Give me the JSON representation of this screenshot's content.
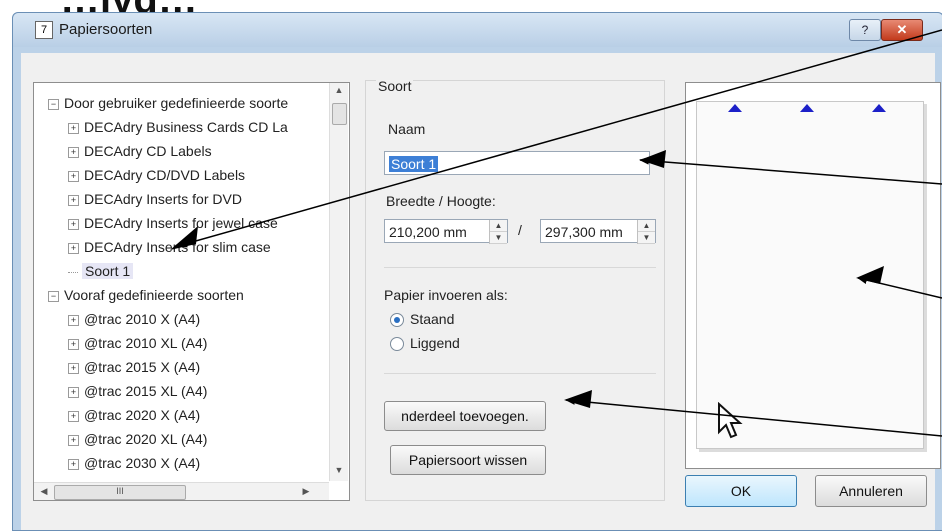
{
  "background_title": "…lyg…",
  "window": {
    "title": "Papiersoorten",
    "help": "?",
    "close": "✕",
    "icon": "7"
  },
  "tree": {
    "items": [
      {
        "label": "Door gebruiker gedefinieerde soorte",
        "exp": "−",
        "level": 0
      },
      {
        "label": "DECAdry Business Cards CD La",
        "exp": "+",
        "level": 1
      },
      {
        "label": "DECAdry CD Labels",
        "exp": "+",
        "level": 1
      },
      {
        "label": "DECAdry CD/DVD Labels",
        "exp": "+",
        "level": 1
      },
      {
        "label": "DECAdry Inserts for DVD",
        "exp": "+",
        "level": 1
      },
      {
        "label": "DECAdry Inserts for jewel case",
        "exp": "+",
        "level": 1
      },
      {
        "label": "DECAdry Inserts for slim case",
        "exp": "+",
        "level": 1
      },
      {
        "label": "Soort 1",
        "exp": "",
        "level": 1,
        "selected": true
      },
      {
        "label": "Vooraf gedefinieerde soorten",
        "exp": "−",
        "level": 0
      },
      {
        "label": "@trac 2010 X (A4)",
        "exp": "+",
        "level": 1
      },
      {
        "label": "@trac 2010 XL (A4)",
        "exp": "+",
        "level": 1
      },
      {
        "label": "@trac 2015 X (A4)",
        "exp": "+",
        "level": 1
      },
      {
        "label": "@trac 2015 XL (A4)",
        "exp": "+",
        "level": 1
      },
      {
        "label": "@trac 2020 X (A4)",
        "exp": "+",
        "level": 1
      },
      {
        "label": "@trac 2020 XL (A4)",
        "exp": "+",
        "level": 1
      },
      {
        "label": "@trac 2030 X (A4)",
        "exp": "+",
        "level": 1
      }
    ],
    "scroll_up": "▲",
    "scroll_down": "▼",
    "scroll_left": "◀",
    "scroll_right": "▶",
    "hthumb_grip": "III"
  },
  "form": {
    "group_label": "Soort",
    "naam_label": "Naam",
    "naam_value": "Soort 1",
    "size_label": "Breedte / Hoogte:",
    "width_value": "210,200 mm",
    "height_value": "297,300 mm",
    "separator": "/",
    "orientation_label": "Papier invoeren als:",
    "orientation_options": [
      "Staand",
      "Liggend"
    ],
    "orientation_selected": "Staand",
    "add_part_button": "nderdeel toevoegen.",
    "delete_button": "Papiersoort wissen"
  },
  "buttons": {
    "ok": "OK",
    "cancel": "Annuleren"
  },
  "colors": {
    "triangle": "#1c20c8",
    "selection": "#3d7fd6"
  }
}
